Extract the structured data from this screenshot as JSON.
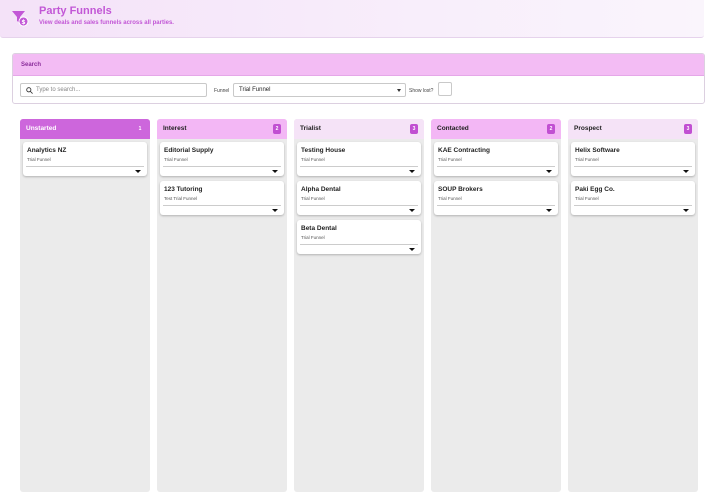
{
  "header": {
    "title": "Party Funnels",
    "subtitle": "View deals and sales funnels across all parties.",
    "icon": "funnel-dollar-icon"
  },
  "search": {
    "section_title": "Search",
    "placeholder": "Type to search...",
    "funnel_label": "Funnel",
    "funnel_value": "Trial Funnel",
    "show_lost_label": "Show lost?"
  },
  "colors": {
    "brand": "#c257d6",
    "unstarted_header": "#cd66dc",
    "interest_header": "#f3b7f5",
    "light_header": "#f5e3f7",
    "count_dark": "#c14fd2"
  },
  "columns": [
    {
      "name": "Unstarted",
      "count": "1",
      "cards": [
        {
          "title": "Analytics NZ",
          "funnel": "Trial Funnel"
        }
      ]
    },
    {
      "name": "Interest",
      "count": "2",
      "cards": [
        {
          "title": "Editorial Supply",
          "funnel": "Trial Funnel"
        },
        {
          "title": "123 Tutoring",
          "funnel": "Test Trial Funnel"
        }
      ]
    },
    {
      "name": "Trialist",
      "count": "3",
      "cards": [
        {
          "title": "Testing House",
          "funnel": "Trial Funnel"
        },
        {
          "title": "Alpha Dental",
          "funnel": "Trial Funnel"
        },
        {
          "title": "Beta Dental",
          "funnel": "Trial Funnel"
        }
      ]
    },
    {
      "name": "Contacted",
      "count": "2",
      "cards": [
        {
          "title": "KAE Contracting",
          "funnel": "Trial Funnel"
        },
        {
          "title": "SOUP Brokers",
          "funnel": "Trial Funnel"
        }
      ]
    },
    {
      "name": "Prospect",
      "count": "3",
      "cards": [
        {
          "title": "Helix Software",
          "funnel": "Trial Funnel"
        },
        {
          "title": "Paki Egg Co.",
          "funnel": "Trial Funnel"
        }
      ]
    }
  ]
}
